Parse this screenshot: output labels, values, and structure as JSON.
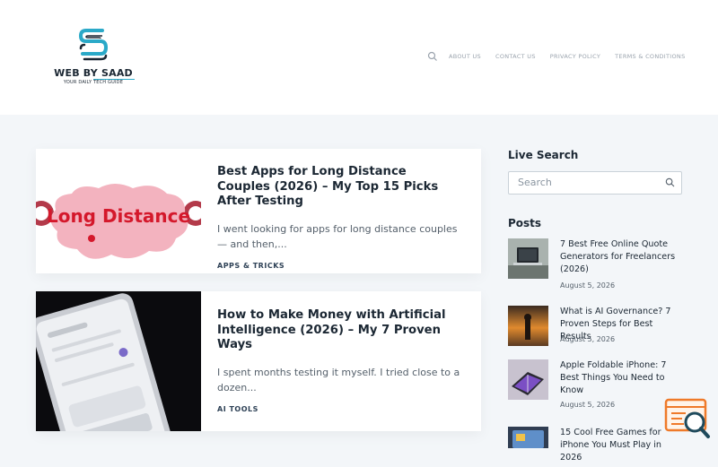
{
  "site": {
    "name": "WEB BY SAAD",
    "tagline": "YOUR DAILY TECH GUIDE"
  },
  "nav": {
    "items": [
      "ABOUT US",
      "CONTACT US",
      "PRIVACY POLICY",
      "TERMS & CONDITIONS"
    ]
  },
  "posts_feed": [
    {
      "title": "Best Apps for Long Distance Couples (2026) – My Top 15 Picks After Testing",
      "excerpt": "I went looking for apps for long distance couples — and then,...",
      "category": "APPS & TRICKS",
      "image_text": "Long Distance"
    },
    {
      "title": "How to Make Money with Artificial Intelligence (2026) – My 7 Proven Ways",
      "excerpt": "I spent months testing it myself. I tried close to a dozen...",
      "category": "AI TOOLS"
    }
  ],
  "sidebar": {
    "live_search_heading": "Live Search",
    "search_placeholder": "Search",
    "posts_heading": "Posts",
    "posts": [
      {
        "title": "7 Best Free Online Quote Generators for Freelancers (2026)",
        "date": "August 5, 2026"
      },
      {
        "title": "What is AI Governance? 7 Proven Steps for Best Results",
        "date": "August 5, 2026"
      },
      {
        "title": "Apple Foldable iPhone: 7 Best Things You Need to Know",
        "date": "August 5, 2026"
      },
      {
        "title": "15 Cool Free Games for iPhone You Must Play in 2026",
        "date": ""
      }
    ]
  },
  "colors": {
    "brand": "#2aa9c8",
    "text_dark": "#1b2733",
    "background": "#f3f6f9"
  },
  "icons": {
    "nav_search": "search-icon",
    "sidebar_search": "search-icon",
    "floating": "search-window-icon"
  }
}
